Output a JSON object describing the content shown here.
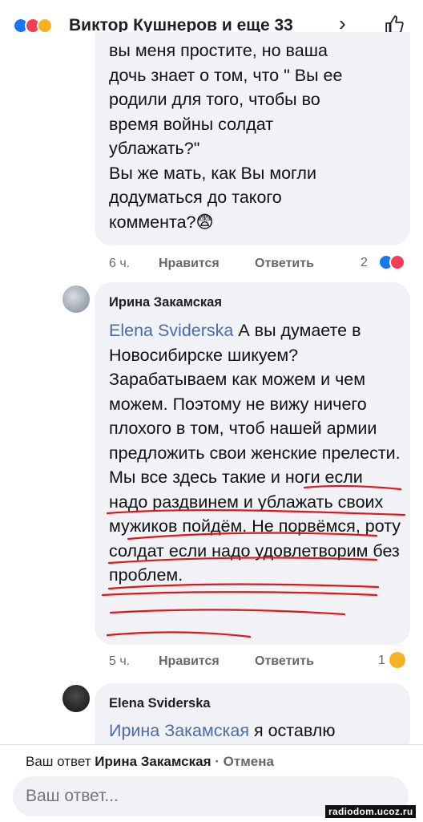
{
  "header": {
    "title": "Виктор Кушнеров и еще 33",
    "chevron": "›",
    "reactions": [
      "like-icon",
      "love-icon",
      "haha-icon"
    ],
    "like_icon": "thumbs-up-icon"
  },
  "comment1": {
    "text": "вы меня простите, но ваша\nдочь знает о том, что \" Вы ее\nродили для того, чтобы во\nвремя войны солдат\nублажать?\"\nВы же мать, как Вы могли\nдодуматься до такого\nкоммента?😨",
    "time": "6 ч.",
    "like_label": "Нравится",
    "reply_label": "Ответить",
    "reaction_count": "2"
  },
  "comment2": {
    "author": "Ирина Закамская",
    "mention": "Elena Sviderska",
    "text": " А вы думаете в Новосибирске шикуем? Зарабатываем как можем и чем можем. Поэтому не вижу ничего плохого в том, чтоб нашей армии предложить свои женские прелести. Мы все здесь такие и ноги если надо раздвинем и ублажать своих мужиков пойдём. Не порвёмся, роту солдат если надо удовлетворим без проблем.",
    "time": "5 ч.",
    "like_label": "Нравится",
    "reply_label": "Ответить",
    "reaction_count": "1"
  },
  "comment3": {
    "author": "Elena Sviderska",
    "mention": "Ирина Закамская",
    "text": " я оставлю"
  },
  "reply_bar": {
    "prefix": "Ваш ответ ",
    "target": "Ирина Закамская",
    "separator": " · ",
    "cancel": "Отмена",
    "placeholder": "Ваш ответ..."
  },
  "watermark": "radiodom.ucoz.ru",
  "colors": {
    "bubble": "#f0f2f5",
    "mention": "#4b6aa8",
    "underline": "#e0161d"
  }
}
